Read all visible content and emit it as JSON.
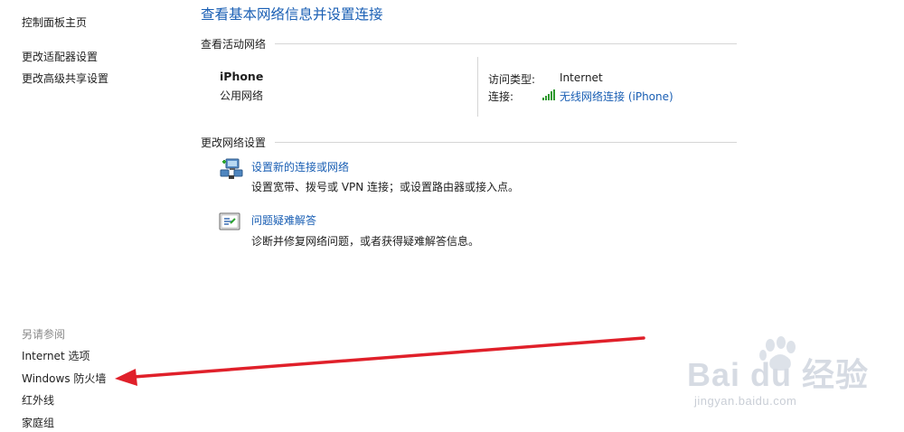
{
  "sidebar": {
    "items": [
      {
        "label": "控制面板主页"
      },
      {
        "label": "更改适配器设置"
      },
      {
        "label": "更改高级共享设置"
      }
    ]
  },
  "see_also": {
    "heading": "另请参阅",
    "items": [
      {
        "label": "Internet 选项"
      },
      {
        "label": "Windows 防火墙"
      },
      {
        "label": "红外线"
      },
      {
        "label": "家庭组"
      }
    ]
  },
  "main": {
    "title": "查看基本网络信息并设置连接",
    "active_networks": {
      "heading": "查看活动网络",
      "network_name": "iPhone",
      "network_type": "公用网络",
      "access_type_label": "访问类型:",
      "access_type_value": "Internet",
      "connection_label": "连接:",
      "connection_link": "无线网络连接 (iPhone)"
    },
    "change_settings": {
      "heading": "更改网络设置",
      "items": [
        {
          "title": "设置新的连接或网络",
          "description": "设置宽带、拨号或 VPN 连接；或设置路由器或接入点。",
          "icon": "network-setup-icon"
        },
        {
          "title": "问题疑难解答",
          "description": "诊断并修复网络问题，或者获得疑难解答信息。",
          "icon": "troubleshoot-icon"
        }
      ]
    }
  },
  "watermark": {
    "brand": "Bai du 经验",
    "url": "jingyan.baidu.com"
  },
  "colors": {
    "link": "#1a5fb4",
    "annotation_arrow": "#e0202a",
    "signal_bars": "#2e9a2e"
  }
}
